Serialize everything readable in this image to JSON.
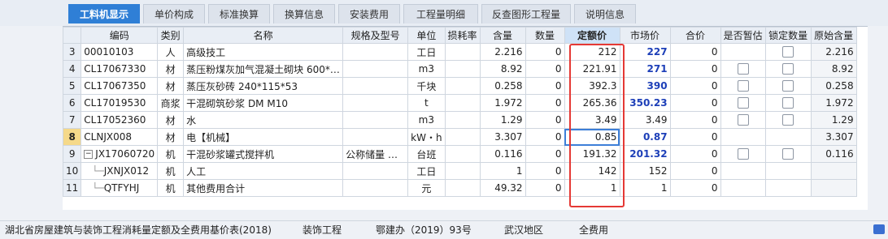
{
  "tabs": [
    "工料机显示",
    "单价构成",
    "标准换算",
    "换算信息",
    "安装费用",
    "工程量明细",
    "反查图形工程量",
    "说明信息"
  ],
  "columns": [
    "编码",
    "类别",
    "名称",
    "规格及型号",
    "单位",
    "损耗率",
    "含量",
    "数量",
    "定额价",
    "市场价",
    "合价",
    "是否暂估",
    "锁定数量",
    "原始含量"
  ],
  "rows": [
    {
      "no": "3",
      "code": "00010103",
      "type": "人",
      "name": "高级技工",
      "spec": "",
      "unit": "工日",
      "loss": "",
      "content": "2.216",
      "qty": "0",
      "quota": "212",
      "market": "227",
      "total": "0",
      "orig": "2.216"
    },
    {
      "no": "4",
      "code": "CL17067330",
      "type": "材",
      "name": "蒸压粉煤灰加气混凝土砌块 600*…",
      "spec": "",
      "unit": "m3",
      "loss": "",
      "content": "8.92",
      "qty": "0",
      "quota": "221.91",
      "market": "271",
      "total": "0",
      "orig": "8.92"
    },
    {
      "no": "5",
      "code": "CL17067350",
      "type": "材",
      "name": "蒸压灰砂砖 240*115*53",
      "spec": "",
      "unit": "千块",
      "loss": "",
      "content": "0.258",
      "qty": "0",
      "quota": "392.3",
      "market": "390",
      "total": "0",
      "orig": "0.258"
    },
    {
      "no": "6",
      "code": "CL17019530",
      "type": "商浆",
      "name": "干混砌筑砂浆 DM M10",
      "spec": "",
      "unit": "t",
      "loss": "",
      "content": "1.972",
      "qty": "0",
      "quota": "265.36",
      "market": "350.23",
      "total": "0",
      "orig": "1.972"
    },
    {
      "no": "7",
      "code": "CL17052360",
      "type": "材",
      "name": "水",
      "spec": "",
      "unit": "m3",
      "loss": "",
      "content": "1.29",
      "qty": "0",
      "quota": "3.49",
      "market": "3.49",
      "total": "0",
      "orig": "1.29"
    },
    {
      "no": "8",
      "code": "CLNJX008",
      "type": "材",
      "name": "电【机械】",
      "spec": "",
      "unit": "kW・h",
      "loss": "",
      "content": "3.307",
      "qty": "0",
      "quota": "0.85",
      "market": "0.87",
      "total": "0",
      "orig": "3.307"
    },
    {
      "no": "9",
      "code": "JX17060720",
      "type": "机",
      "name": "干混砂浆罐式搅拌机",
      "spec": "公称储量 …",
      "unit": "台班",
      "loss": "",
      "content": "0.116",
      "qty": "0",
      "quota": "191.32",
      "market": "201.32",
      "total": "0",
      "orig": "0.116"
    },
    {
      "no": "10",
      "code": "JXNJX012",
      "type": "机",
      "name": "人工",
      "spec": "",
      "unit": "工日",
      "loss": "",
      "content": "1",
      "qty": "0",
      "quota": "142",
      "market": "152",
      "total": "0",
      "orig": ""
    },
    {
      "no": "11",
      "code": "QTFYHJ",
      "type": "机",
      "name": "其他费用合计",
      "spec": "",
      "unit": "元",
      "loss": "",
      "content": "49.32",
      "qty": "0",
      "quota": "1",
      "market": "1",
      "total": "0",
      "orig": ""
    }
  ],
  "status": {
    "standard": "湖北省房屋建筑与装饰工程消耗量定额及全费用基价表(2018)",
    "project": "装饰工程",
    "doc": "鄂建办（2019）93号",
    "region": "武汉地区",
    "fee": "全费用"
  }
}
